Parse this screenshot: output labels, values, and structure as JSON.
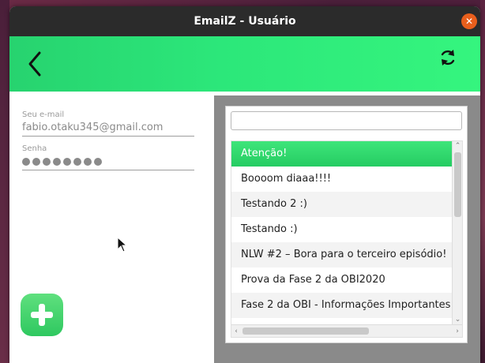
{
  "window": {
    "title": "EmailZ - Usuário",
    "close_symbol": "✕"
  },
  "header": {
    "back_icon": "back-arrow-icon",
    "refresh_icon": "refresh-icon",
    "color": "#2ce77a"
  },
  "form": {
    "email_label": "Seu e-mail",
    "email_value": "fabio.otaku345@gmail.com",
    "password_label": "Senha",
    "password_masked_length": 8
  },
  "add_button": {
    "icon": "plus-icon",
    "color": "#3bd467"
  },
  "list": {
    "search_placeholder": "",
    "items": [
      "Atenção!",
      "Boooom diaaa!!!!",
      "Testando 2 :)",
      "Testando :)",
      "NLW #2 – Bora para o terceiro episódio!",
      "Prova da Fase 2 da OBI2020",
      "Fase 2 da OBI - Informações Importantes"
    ],
    "selected_index": 0,
    "scroll_up": "⌃",
    "scroll_down": "⌄",
    "scroll_left": "‹",
    "scroll_right": "›",
    "selected_color": "#2fd66a"
  }
}
